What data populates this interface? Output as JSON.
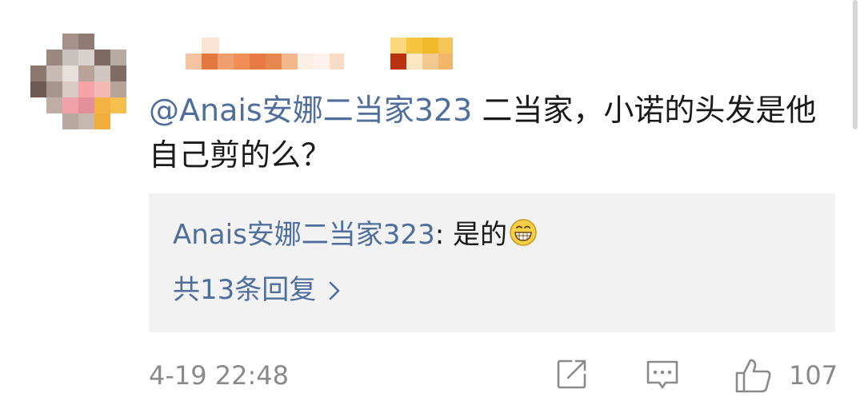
{
  "comment": {
    "mention": "@Anais安娜二当家323",
    "text": " 二当家，小诺的头发是他自己剪的么？"
  },
  "reply": {
    "user": "Anais安娜二当家323",
    "separator": ": ",
    "text": "是的",
    "emoji_icon": "grinning-face-icon",
    "more_label": "共13条回复"
  },
  "footer": {
    "timestamp": "4-19 22:48",
    "like_count": "107"
  },
  "colors": {
    "link": "#4f6e9c",
    "text": "#1a1a1a",
    "muted": "#8a8a8a",
    "reply_bg": "#f2f2f2"
  }
}
